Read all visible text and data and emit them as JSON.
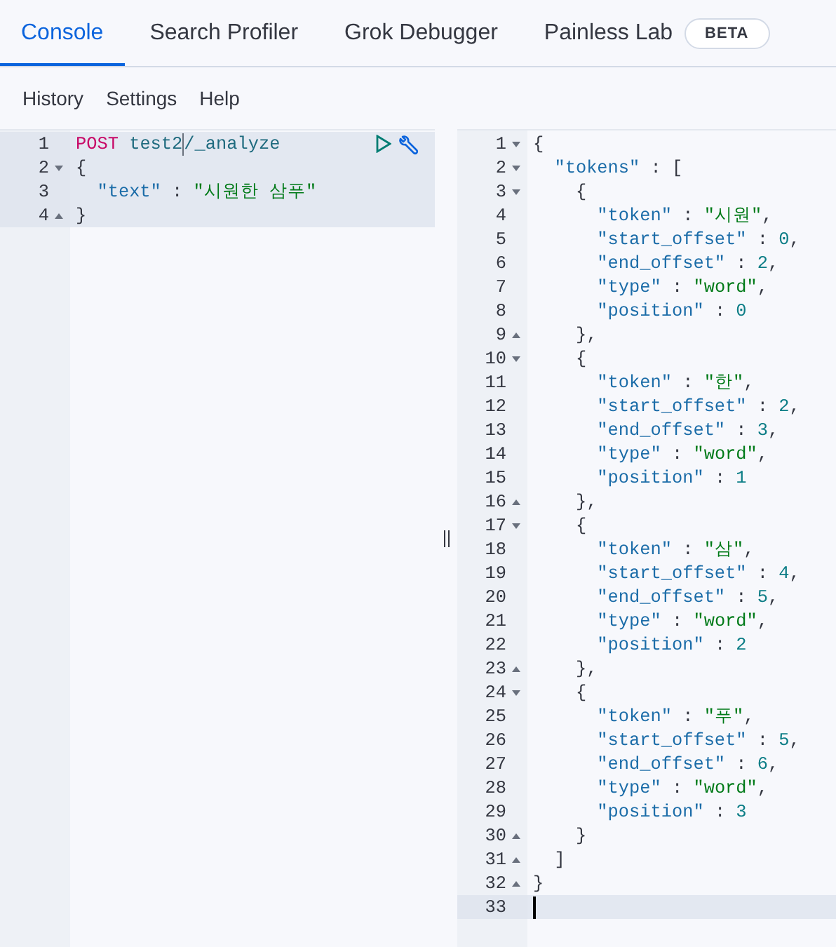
{
  "tabs": [
    {
      "label": "Console",
      "selected": true
    },
    {
      "label": "Search Profiler",
      "selected": false
    },
    {
      "label": "Grok Debugger",
      "selected": false
    },
    {
      "label": "Painless Lab",
      "selected": false,
      "badge": "BETA"
    }
  ],
  "menu": [
    "History",
    "Settings",
    "Help"
  ],
  "request_editor": {
    "lines": [
      {
        "number": "1",
        "highlighted": true,
        "actions": true,
        "segments": [
          {
            "kind": "method",
            "text": "POST "
          },
          {
            "kind": "url",
            "text": "test2"
          },
          {
            "kind": "cursor"
          },
          {
            "kind": "url",
            "text": "/_analyze"
          }
        ]
      },
      {
        "number": "2",
        "highlighted": true,
        "kind": "fold_start",
        "segments": [
          {
            "kind": "punct",
            "text": "{"
          }
        ]
      },
      {
        "number": "3",
        "highlighted": true,
        "segments": [
          {
            "kind": "key",
            "text": "  \"text\""
          },
          {
            "kind": "punct",
            "text": " : "
          },
          {
            "kind": "string",
            "text": "\"시원한 삼푸\""
          }
        ]
      },
      {
        "number": "4",
        "highlighted": true,
        "kind": "fold_end",
        "segments": [
          {
            "kind": "punct",
            "text": "}"
          }
        ]
      }
    ]
  },
  "response_editor": {
    "lines": [
      {
        "number": "1",
        "highlighted": false,
        "kind": "fold_start",
        "segments": [
          {
            "kind": "punct",
            "text": "{"
          }
        ]
      },
      {
        "number": "2",
        "highlighted": false,
        "kind": "fold_start",
        "segments": [
          {
            "kind": "key",
            "text": "  \"tokens\""
          },
          {
            "kind": "punct",
            "text": " : ["
          }
        ]
      },
      {
        "number": "3",
        "highlighted": false,
        "kind": "fold_start",
        "segments": [
          {
            "kind": "punct",
            "text": "    {"
          }
        ]
      },
      {
        "number": "4",
        "highlighted": false,
        "segments": [
          {
            "kind": "key",
            "text": "      \"token\""
          },
          {
            "kind": "punct",
            "text": " : "
          },
          {
            "kind": "string",
            "text": "\"시원\""
          },
          {
            "kind": "punct",
            "text": ","
          }
        ]
      },
      {
        "number": "5",
        "highlighted": false,
        "segments": [
          {
            "kind": "key",
            "text": "      \"start_offset\""
          },
          {
            "kind": "punct",
            "text": " : "
          },
          {
            "kind": "number",
            "text": "0"
          },
          {
            "kind": "punct",
            "text": ","
          }
        ]
      },
      {
        "number": "6",
        "highlighted": false,
        "segments": [
          {
            "kind": "key",
            "text": "      \"end_offset\""
          },
          {
            "kind": "punct",
            "text": " : "
          },
          {
            "kind": "number",
            "text": "2"
          },
          {
            "kind": "punct",
            "text": ","
          }
        ]
      },
      {
        "number": "7",
        "highlighted": false,
        "segments": [
          {
            "kind": "key",
            "text": "      \"type\""
          },
          {
            "kind": "punct",
            "text": " : "
          },
          {
            "kind": "string",
            "text": "\"word\""
          },
          {
            "kind": "punct",
            "text": ","
          }
        ]
      },
      {
        "number": "8",
        "highlighted": false,
        "segments": [
          {
            "kind": "key",
            "text": "      \"position\""
          },
          {
            "kind": "punct",
            "text": " : "
          },
          {
            "kind": "number",
            "text": "0"
          }
        ]
      },
      {
        "number": "9",
        "highlighted": false,
        "kind": "fold_end",
        "segments": [
          {
            "kind": "punct",
            "text": "    },"
          }
        ]
      },
      {
        "number": "10",
        "highlighted": false,
        "kind": "fold_start",
        "segments": [
          {
            "kind": "punct",
            "text": "    {"
          }
        ]
      },
      {
        "number": "11",
        "highlighted": false,
        "segments": [
          {
            "kind": "key",
            "text": "      \"token\""
          },
          {
            "kind": "punct",
            "text": " : "
          },
          {
            "kind": "string",
            "text": "\"한\""
          },
          {
            "kind": "punct",
            "text": ","
          }
        ]
      },
      {
        "number": "12",
        "highlighted": false,
        "segments": [
          {
            "kind": "key",
            "text": "      \"start_offset\""
          },
          {
            "kind": "punct",
            "text": " : "
          },
          {
            "kind": "number",
            "text": "2"
          },
          {
            "kind": "punct",
            "text": ","
          }
        ]
      },
      {
        "number": "13",
        "highlighted": false,
        "segments": [
          {
            "kind": "key",
            "text": "      \"end_offset\""
          },
          {
            "kind": "punct",
            "text": " : "
          },
          {
            "kind": "number",
            "text": "3"
          },
          {
            "kind": "punct",
            "text": ","
          }
        ]
      },
      {
        "number": "14",
        "highlighted": false,
        "segments": [
          {
            "kind": "key",
            "text": "      \"type\""
          },
          {
            "kind": "punct",
            "text": " : "
          },
          {
            "kind": "string",
            "text": "\"word\""
          },
          {
            "kind": "punct",
            "text": ","
          }
        ]
      },
      {
        "number": "15",
        "highlighted": false,
        "segments": [
          {
            "kind": "key",
            "text": "      \"position\""
          },
          {
            "kind": "punct",
            "text": " : "
          },
          {
            "kind": "number",
            "text": "1"
          }
        ]
      },
      {
        "number": "16",
        "highlighted": false,
        "kind": "fold_end",
        "segments": [
          {
            "kind": "punct",
            "text": "    },"
          }
        ]
      },
      {
        "number": "17",
        "highlighted": false,
        "kind": "fold_start",
        "segments": [
          {
            "kind": "punct",
            "text": "    {"
          }
        ]
      },
      {
        "number": "18",
        "highlighted": false,
        "segments": [
          {
            "kind": "key",
            "text": "      \"token\""
          },
          {
            "kind": "punct",
            "text": " : "
          },
          {
            "kind": "string",
            "text": "\"삼\""
          },
          {
            "kind": "punct",
            "text": ","
          }
        ]
      },
      {
        "number": "19",
        "highlighted": false,
        "segments": [
          {
            "kind": "key",
            "text": "      \"start_offset\""
          },
          {
            "kind": "punct",
            "text": " : "
          },
          {
            "kind": "number",
            "text": "4"
          },
          {
            "kind": "punct",
            "text": ","
          }
        ]
      },
      {
        "number": "20",
        "highlighted": false,
        "segments": [
          {
            "kind": "key",
            "text": "      \"end_offset\""
          },
          {
            "kind": "punct",
            "text": " : "
          },
          {
            "kind": "number",
            "text": "5"
          },
          {
            "kind": "punct",
            "text": ","
          }
        ]
      },
      {
        "number": "21",
        "highlighted": false,
        "segments": [
          {
            "kind": "key",
            "text": "      \"type\""
          },
          {
            "kind": "punct",
            "text": " : "
          },
          {
            "kind": "string",
            "text": "\"word\""
          },
          {
            "kind": "punct",
            "text": ","
          }
        ]
      },
      {
        "number": "22",
        "highlighted": false,
        "segments": [
          {
            "kind": "key",
            "text": "      \"position\""
          },
          {
            "kind": "punct",
            "text": " : "
          },
          {
            "kind": "number",
            "text": "2"
          }
        ]
      },
      {
        "number": "23",
        "highlighted": false,
        "kind": "fold_end",
        "segments": [
          {
            "kind": "punct",
            "text": "    },"
          }
        ]
      },
      {
        "number": "24",
        "highlighted": false,
        "kind": "fold_start",
        "segments": [
          {
            "kind": "punct",
            "text": "    {"
          }
        ]
      },
      {
        "number": "25",
        "highlighted": false,
        "segments": [
          {
            "kind": "key",
            "text": "      \"token\""
          },
          {
            "kind": "punct",
            "text": " : "
          },
          {
            "kind": "string",
            "text": "\"푸\""
          },
          {
            "kind": "punct",
            "text": ","
          }
        ]
      },
      {
        "number": "26",
        "highlighted": false,
        "segments": [
          {
            "kind": "key",
            "text": "      \"start_offset\""
          },
          {
            "kind": "punct",
            "text": " : "
          },
          {
            "kind": "number",
            "text": "5"
          },
          {
            "kind": "punct",
            "text": ","
          }
        ]
      },
      {
        "number": "27",
        "highlighted": false,
        "segments": [
          {
            "kind": "key",
            "text": "      \"end_offset\""
          },
          {
            "kind": "punct",
            "text": " : "
          },
          {
            "kind": "number",
            "text": "6"
          },
          {
            "kind": "punct",
            "text": ","
          }
        ]
      },
      {
        "number": "28",
        "highlighted": false,
        "segments": [
          {
            "kind": "key",
            "text": "      \"type\""
          },
          {
            "kind": "punct",
            "text": " : "
          },
          {
            "kind": "string",
            "text": "\"word\""
          },
          {
            "kind": "punct",
            "text": ","
          }
        ]
      },
      {
        "number": "29",
        "highlighted": false,
        "segments": [
          {
            "kind": "key",
            "text": "      \"position\""
          },
          {
            "kind": "punct",
            "text": " : "
          },
          {
            "kind": "number",
            "text": "3"
          }
        ]
      },
      {
        "number": "30",
        "highlighted": false,
        "kind": "fold_end",
        "segments": [
          {
            "kind": "punct",
            "text": "    }"
          }
        ]
      },
      {
        "number": "31",
        "highlighted": false,
        "kind": "fold_end",
        "segments": [
          {
            "kind": "punct",
            "text": "  ]"
          }
        ]
      },
      {
        "number": "32",
        "highlighted": false,
        "kind": "fold_end",
        "segments": [
          {
            "kind": "punct",
            "text": "}"
          }
        ]
      },
      {
        "number": "33",
        "highlighted": true,
        "segments": [
          {
            "kind": "cursor"
          }
        ]
      }
    ]
  }
}
